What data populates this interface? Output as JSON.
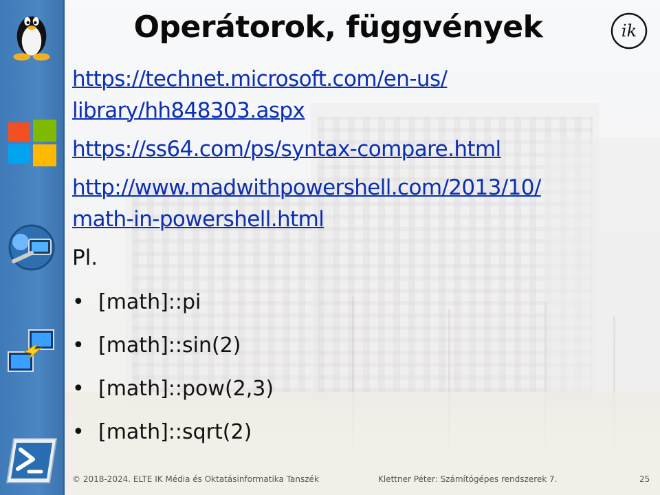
{
  "slide": {
    "title": "Operátorok, függvények",
    "links": [
      {
        "line1": "https://technet.microsoft.com/en-us/",
        "line2": "library/hh848303.aspx"
      },
      {
        "line1": "https://ss64.com/ps/syntax-compare.html",
        "line2": ""
      },
      {
        "line1": "http://www.madwithpowershell.com/2013/10/",
        "line2": "math-in-powershell.html"
      }
    ],
    "example_label": "Pl.",
    "bullet_glyph": "•",
    "examples": [
      "[math]::pi",
      "[math]::sin(2)",
      "[math]::pow(2,3)",
      "[math]::sqrt(2)"
    ]
  },
  "sidebar": {
    "icons": [
      "linux-tux-icon",
      "windows-logo-icon",
      "network-admin-icon",
      "file-transfer-icon",
      "powershell-icon"
    ]
  },
  "logo": {
    "text": "ik"
  },
  "footer": {
    "left": "© 2018-2024. ELTE IK Média és Oktatásinformatika Tanszék",
    "center": "Klettner Péter: Számítógépes rendszerek 7.",
    "page": "25"
  },
  "colors": {
    "link": "#0b2fb3",
    "sidebar": "#4a86c2",
    "title": "#0a0a0a"
  }
}
